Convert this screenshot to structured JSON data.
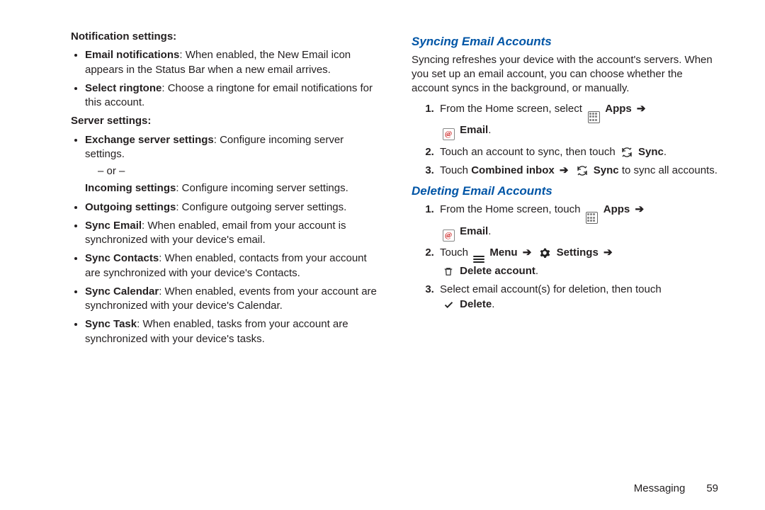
{
  "footer": {
    "section": "Messaging",
    "page": "59"
  },
  "left": {
    "notif_heading": "Notification settings:",
    "notif_items": {
      "b0": "Email notifications",
      "t0": ": When enabled, the New Email icon appears in the Status Bar when a new email arrives.",
      "b1": "Select ringtone",
      "t1": ": Choose a ringtone for email notifications for this account."
    },
    "server_heading": "Server settings:",
    "server_items": {
      "b0": "Exchange server settings",
      "t0": ": Configure incoming server settings.",
      "or": "– or –",
      "b0b": "Incoming settings",
      "t0b": ": Configure incoming server settings.",
      "b1": "Outgoing settings",
      "t1": ": Configure outgoing server settings.",
      "b2": "Sync Email",
      "t2": ": When enabled, email from your account is synchronized with your device's email.",
      "b3": "Sync Contacts",
      "t3": ": When enabled, contacts from your account are synchronized with your device's Contacts.",
      "b4": "Sync Calendar",
      "t4": ": When enabled, events from your account are synchronized with your device's Calendar.",
      "b5": "Sync Task",
      "t5": ": When enabled, tasks from your account are synchronized with your device's tasks."
    }
  },
  "right": {
    "syncing": {
      "heading": "Syncing Email Accounts",
      "intro": "Syncing refreshes your device with the account's servers. When you set up an email account, you can choose whether the account syncs in the background, or manually.",
      "s1a": "From the Home screen, select ",
      "apps_label": " Apps ",
      "email_label": " Email",
      "s2a": "Touch an account to sync, then touch ",
      "sync_label": " Sync",
      "s3a": "Touch ",
      "s3b": "Combined inbox ",
      "s3c": " to sync all accounts."
    },
    "deleting": {
      "heading": "Deleting Email Accounts",
      "s1a": "From the Home screen, touch ",
      "apps_label": " Apps ",
      "email_label": " Email",
      "s2a": "Touch ",
      "menu_label": " Menu ",
      "settings_label": " Settings ",
      "delete_acct_label": " Delete account",
      "s3a": "Select email account(s) for deletion, then touch ",
      "delete_label": " Delete"
    },
    "glyphs": {
      "dot": ".",
      "arrow": "➔"
    }
  }
}
